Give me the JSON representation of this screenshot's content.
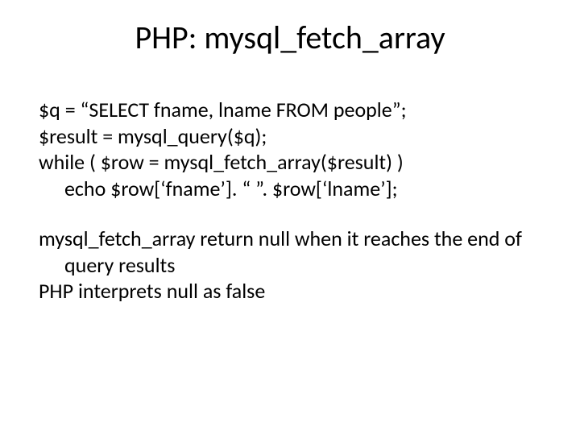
{
  "title": "PHP: mysql_fetch_array",
  "code": {
    "l1": "$q = “SELECT fname, lname FROM people”;",
    "l2": "$result = mysql_query($q);",
    "l3": "while ( $row = mysql_fetch_array($result) )",
    "l4": "echo $row[‘fname’]. “ ”. $row[‘lname’];"
  },
  "notes": {
    "n1": "mysql_fetch_array return null when it reaches the end of query results",
    "n2": "PHP interprets null as false"
  }
}
